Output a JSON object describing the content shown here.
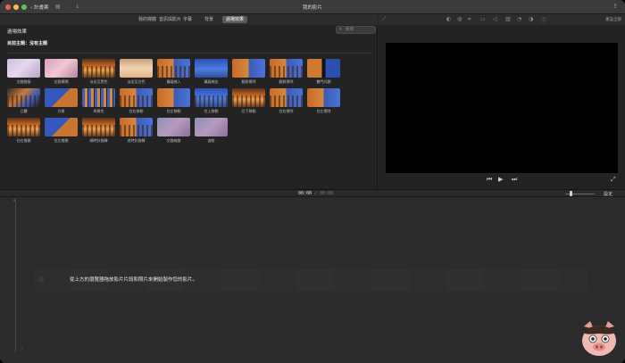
{
  "window": {
    "back_label": "計畫案",
    "title": "我的影片"
  },
  "tabs": [
    {
      "label": "我的媒體",
      "active": false
    },
    {
      "label": "音訊與影片",
      "active": false
    },
    {
      "label": "字幕",
      "active": false
    },
    {
      "label": "背景",
      "active": false
    },
    {
      "label": "過場效果",
      "active": true
    }
  ],
  "browser": {
    "title": "過場效果",
    "search_placeholder": "搜尋",
    "subheading": "目前主題：沒有主題",
    "transitions": [
      {
        "label": "交錯融接",
        "style": "t-pale"
      },
      {
        "label": "交錯模糊",
        "style": "t-pink"
      },
      {
        "label": "淡出至黑色",
        "style": "t-forest t-trees"
      },
      {
        "label": "淡出至白色",
        "style": "t-forest-l"
      },
      {
        "label": "擴展縮入",
        "style": "t-half t-trees"
      },
      {
        "label": "擴展縮出",
        "style": "t-blue"
      },
      {
        "label": "翻頁擦除",
        "style": "t-half"
      },
      {
        "label": "翻頁擦除",
        "style": "t-half t-trees"
      },
      {
        "label": "雙門式開",
        "style": "t-door"
      },
      {
        "label": "立體",
        "style": "t-cube t-trees"
      },
      {
        "label": "方格",
        "style": "t-split"
      },
      {
        "label": "馬賽克",
        "style": "t-mosaic"
      },
      {
        "label": "往右移動",
        "style": "t-half t-trees"
      },
      {
        "label": "往左移動",
        "style": "t-half"
      },
      {
        "label": "往上移動",
        "style": "t-blue t-trees"
      },
      {
        "label": "往下移動",
        "style": "t-forest t-trees"
      },
      {
        "label": "往右擦除",
        "style": "t-half t-trees"
      },
      {
        "label": "往左擦除",
        "style": "t-half"
      },
      {
        "label": "往右推開",
        "style": "t-forest t-trees"
      },
      {
        "label": "往左推開",
        "style": "t-split"
      },
      {
        "label": "順時針旋轉",
        "style": "t-forest t-trees"
      },
      {
        "label": "逆時針旋轉",
        "style": "t-half t-trees"
      },
      {
        "label": "交錯縮放",
        "style": "t-blur"
      },
      {
        "label": "波紋",
        "style": "t-blur"
      }
    ]
  },
  "viewer": {
    "tools": [
      "magic-wand-icon",
      "color-balance-icon",
      "color-correction-icon",
      "crop-icon",
      "stabilization-icon",
      "volume-icon",
      "noise-reduction-icon",
      "speed-icon",
      "filter-icon",
      "info-icon"
    ],
    "reset_label": "重設全部"
  },
  "timeline": {
    "current_time": "00:00",
    "total_time": "00:00",
    "settings_label": "設定",
    "drop_hint": "從上方的瀏覽器拖放影片片段和照片來開始製作您的影片。"
  }
}
